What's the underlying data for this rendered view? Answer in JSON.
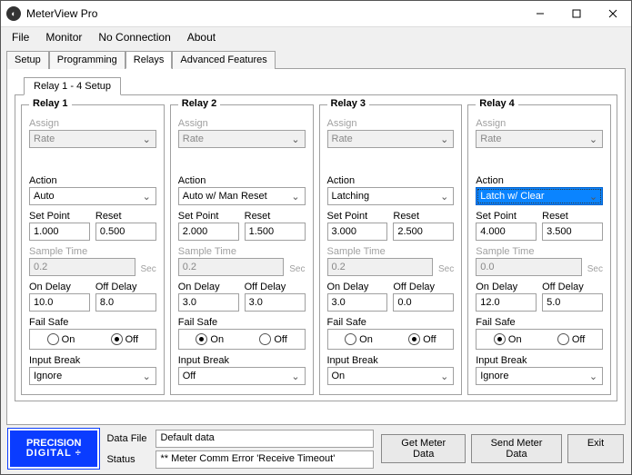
{
  "window": {
    "title": "MeterView Pro"
  },
  "menu": {
    "file": "File",
    "monitor": "Monitor",
    "conn": "No Connection",
    "about": "About"
  },
  "tabs": {
    "setup": "Setup",
    "programming": "Programming",
    "relays": "Relays",
    "advanced": "Advanced Features"
  },
  "subtab": "Relay 1 - 4 Setup",
  "labels": {
    "assign": "Assign",
    "action": "Action",
    "setpoint": "Set Point",
    "reset": "Reset",
    "sample": "Sample Time",
    "sec": "Sec",
    "ondelay": "On Delay",
    "offdelay": "Off Delay",
    "failsafe": "Fail Safe",
    "on": "On",
    "off": "Off",
    "inputbreak": "Input Break"
  },
  "relays": [
    {
      "title": "Relay  1",
      "assign": "Rate",
      "action": "Auto",
      "hl": false,
      "setpoint": "1.000",
      "reset": "0.500",
      "sample": "0.2",
      "ondelay": "10.0",
      "offdelay": "8.0",
      "failsafe": "off",
      "inputbreak": "Ignore"
    },
    {
      "title": "Relay  2",
      "assign": "Rate",
      "action": "Auto w/ Man Reset",
      "hl": false,
      "setpoint": "2.000",
      "reset": "1.500",
      "sample": "0.2",
      "ondelay": "3.0",
      "offdelay": "3.0",
      "failsafe": "on",
      "inputbreak": "Off"
    },
    {
      "title": "Relay  3",
      "assign": "Rate",
      "action": "Latching",
      "hl": false,
      "setpoint": "3.000",
      "reset": "2.500",
      "sample": "0.2",
      "ondelay": "3.0",
      "offdelay": "0.0",
      "failsafe": "off",
      "inputbreak": "On"
    },
    {
      "title": "Relay  4",
      "assign": "Rate",
      "action": "Latch w/ Clear",
      "hl": true,
      "setpoint": "4.000",
      "reset": "3.500",
      "sample": "0.0",
      "ondelay": "12.0",
      "offdelay": "5.0",
      "failsafe": "on",
      "inputbreak": "Ignore"
    }
  ],
  "footer": {
    "logo1": "PRECISION",
    "logo2": "DIGITAL ÷",
    "datafile_lbl": "Data File",
    "datafile": "Default data",
    "status_lbl": "Status",
    "status": "** Meter Comm Error   'Receive Timeout'",
    "get": "Get Meter Data",
    "send": "Send Meter Data",
    "exit": "Exit"
  }
}
